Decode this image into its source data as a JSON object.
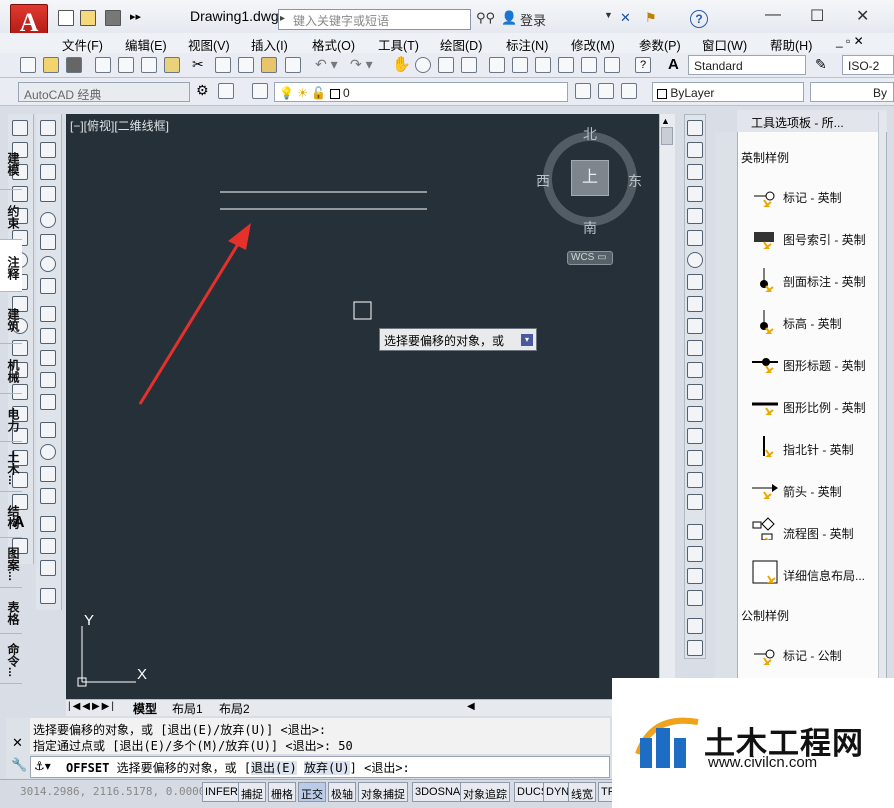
{
  "window": {
    "title": "Drawing1.dwg",
    "search_placeholder": "键入关键字或短语",
    "login_label": "登录"
  },
  "menu": [
    "文件(F)",
    "编辑(E)",
    "视图(V)",
    "插入(I)",
    "格式(O)",
    "工具(T)",
    "绘图(D)",
    "标注(N)",
    "修改(M)",
    "参数(P)",
    "窗口(W)",
    "帮助(H)"
  ],
  "toolbar": {
    "text_style": "Standard",
    "dim_style": "ISO-2",
    "workspace": "AutoCAD 经典",
    "layer": "0",
    "color": "ByLayer",
    "linetype": "By"
  },
  "viewport": {
    "label": "[−][俯视][二维线框]",
    "compass": {
      "north": "北",
      "south": "南",
      "east": "东",
      "west": "西",
      "top": "上"
    },
    "wcs": "WCS",
    "ucs_x": "X",
    "ucs_y": "Y",
    "tooltip": "选择要偏移的对象，或"
  },
  "tabs": [
    "模型",
    "布局1",
    "布局2"
  ],
  "command": {
    "history": [
      "选择要偏移的对象，或 [退出(E)/放弃(U)] <退出>:",
      "指定通过点或 [退出(E)/多个(M)/放弃(U)] <退出>: 50"
    ],
    "prompt_cmd": "OFFSET",
    "prompt_text": "选择要偏移的对象，或 [",
    "opt_exit": "退出(E)",
    "opt_undo": "放弃(U)",
    "prompt_tail": "] <退出>:"
  },
  "status": {
    "coords": "3014.2986, 2116.5178, 0.0000",
    "buttons": [
      "INFER",
      "捕捉",
      "栅格",
      "正交",
      "极轴",
      "对象捕捉",
      "3DOSNAP",
      "对象追踪",
      "DUCS",
      "DYN",
      "线宽",
      "TP"
    ]
  },
  "palette": {
    "title": "工具选项板 - 所...",
    "tabs": [
      "建模",
      "约束",
      "注释",
      "建筑",
      "机械",
      "电力",
      "土木...",
      "结构",
      "图案...",
      "表格",
      "命令..."
    ],
    "section1": "英制样例",
    "items": [
      "标记 - 英制",
      "图号索引 - 英制",
      "剖面标注 - 英制",
      "标高 - 英制",
      "图形标题 - 英制",
      "图形比例 - 英制",
      "指北针 - 英制",
      "箭头 - 英制",
      "流程图 - 英制",
      "详细信息布局..."
    ],
    "section2": "公制样例",
    "item_metric": "标记 - 公制"
  },
  "watermark": {
    "name": "土木工程网",
    "url": "www.civilcn.com"
  },
  "colors": {
    "canvas": "#253038",
    "accent_red": "#e5302c"
  }
}
